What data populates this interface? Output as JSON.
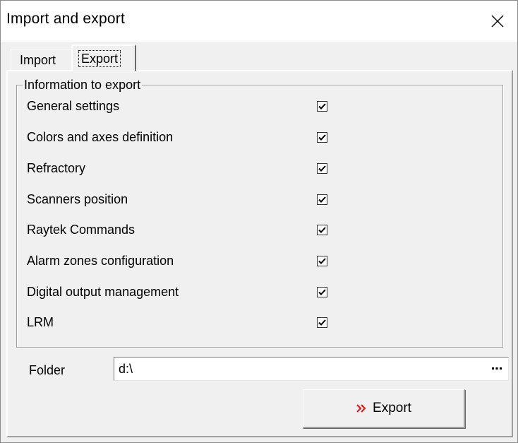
{
  "window": {
    "title": "Import and export",
    "close_icon": "close-icon"
  },
  "tabs": [
    {
      "label": "Import",
      "selected": false
    },
    {
      "label": "Export",
      "selected": true
    }
  ],
  "export_panel": {
    "group_title": "Information to export",
    "options": [
      {
        "label": "General settings",
        "checked": true
      },
      {
        "label": "Colors and axes definition",
        "checked": true
      },
      {
        "label": "Refractory",
        "checked": true
      },
      {
        "label": "Scanners position",
        "checked": true
      },
      {
        "label": "Raytek Commands",
        "checked": true
      },
      {
        "label": "Alarm zones configuration",
        "checked": true
      },
      {
        "label": "Digital output management",
        "checked": true
      },
      {
        "label": "LRM",
        "checked": true
      }
    ],
    "folder_label": "Folder",
    "folder_value": "d:\\",
    "browse_icon": "ellipsis-icon",
    "export_button_label": "Export",
    "export_icon": "double-chevron-right-icon",
    "export_icon_color": "#e02020"
  }
}
